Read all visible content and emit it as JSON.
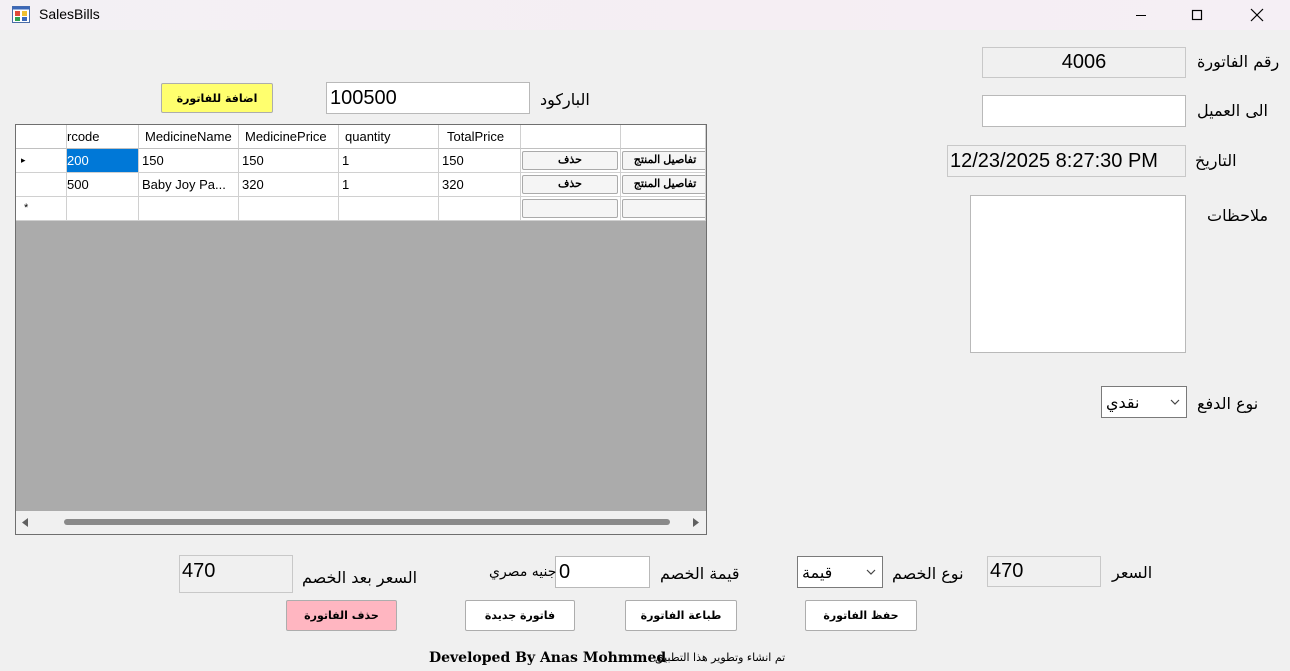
{
  "window": {
    "title": "SalesBills"
  },
  "invoice": {
    "number_label": "رقم الفاتورة",
    "number_value": "4006",
    "customer_label": "الى العميل",
    "customer_value": "",
    "date_label": "التاريخ",
    "date_value": "12/23/2025 8:27:30 PM",
    "notes_label": "ملاحظات",
    "notes_value": "",
    "payment_label": "نوع الدفع",
    "payment_value": "نقدي"
  },
  "barcode": {
    "label": "الباركود",
    "value": "100500",
    "add_button": "اضافة للفاتورة"
  },
  "grid": {
    "columns": [
      "rcode",
      "MedicineName",
      "MedicinePrice",
      "quantity",
      "TotalPrice",
      "",
      ""
    ],
    "rows": [
      {
        "indicator": "▸",
        "code": "200",
        "name": "150",
        "price": "150",
        "qty": "1",
        "total": "150",
        "delete": "حذف",
        "details": "تفاصيل المنتج"
      },
      {
        "indicator": "",
        "code": "500",
        "name": "Baby Joy Pa...",
        "price": "320",
        "qty": "1",
        "total": "320",
        "delete": "حذف",
        "details": "تفاصيل المنتج"
      }
    ],
    "new_row_indicator": "*"
  },
  "totals": {
    "price_label": "السعر",
    "price_value": "470",
    "discount_type_label": "نوع الخصم",
    "discount_type_value": "قيمة",
    "discount_value_label": "قيمة الخصم",
    "discount_value": "0",
    "currency": "جنيه مصري",
    "after_discount_label": "السعر بعد الخصم",
    "after_discount_value": "470"
  },
  "actions": {
    "save": "حفظ الفاتورة",
    "print": "طباعة الفاتورة",
    "new": "فاتورة جديدة",
    "delete": "حذف الفاتورة"
  },
  "footer": {
    "credit": "Developed By Anas Mohmmed",
    "arabic": "تم انشاء وتطوير هذا التطبيق"
  },
  "colors": {
    "add_button": "#ffff6e",
    "delete_button": "#ffb6c1",
    "selected_cell": "#0078d7"
  }
}
